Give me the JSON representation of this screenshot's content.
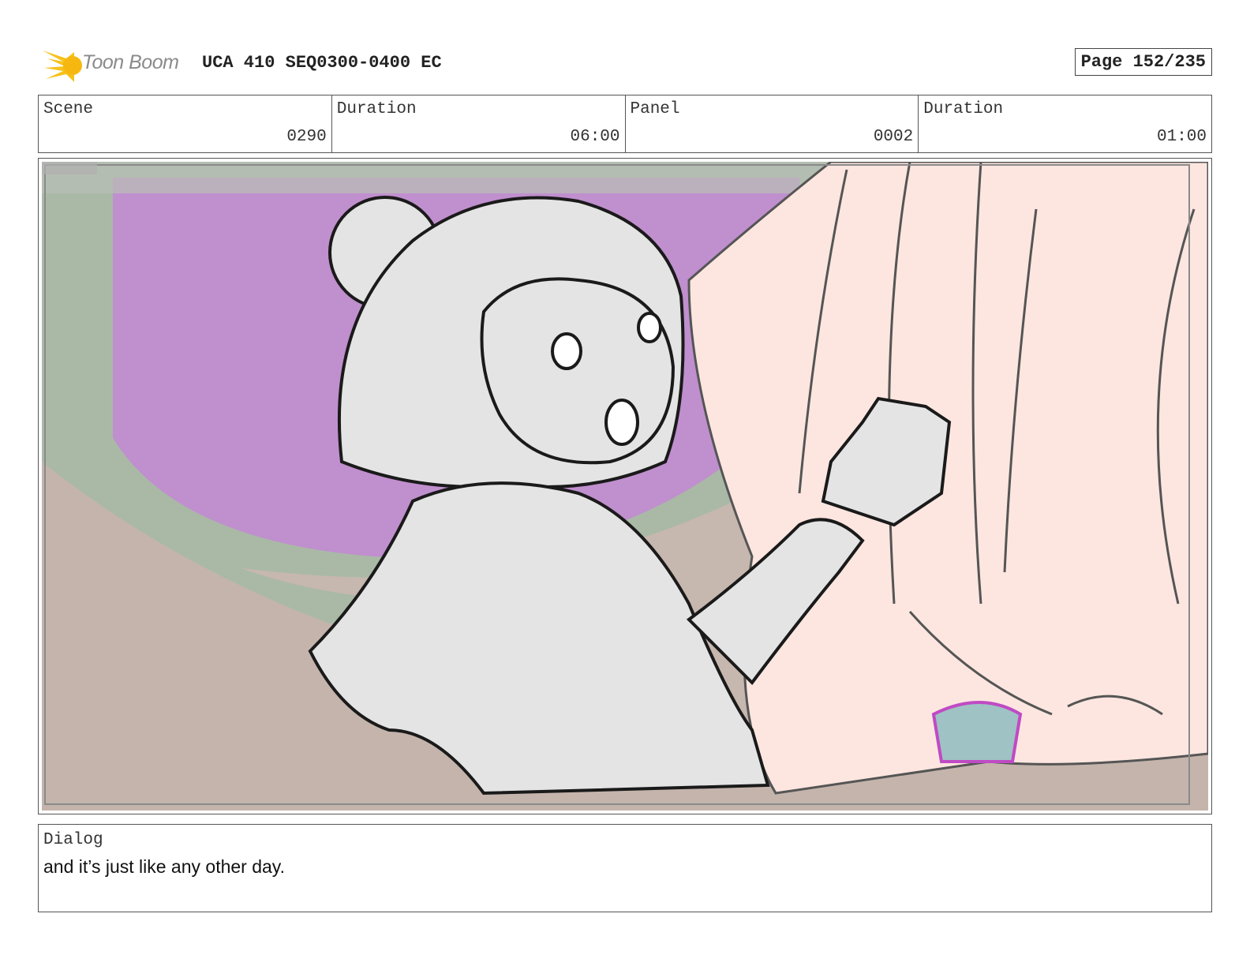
{
  "header": {
    "logo_text": "Toon Boom",
    "project_title": "UCA 410 SEQ0300-0400 EC",
    "page_label": "Page 152/235"
  },
  "info": {
    "scene": {
      "label": "Scene",
      "value": "0290"
    },
    "scene_duration": {
      "label": "Duration",
      "value": "06:00"
    },
    "panel": {
      "label": "Panel",
      "value": "0002"
    },
    "panel_duration": {
      "label": "Duration",
      "value": "01:00"
    }
  },
  "dialog": {
    "label": "Dialog",
    "text": "and it’s just like any other day."
  },
  "colors": {
    "purple_bg": "#c08fce",
    "green_pipe": "#a9b9a6",
    "floor_brown": "#c9b9b1",
    "pink_figure": "#fde6e0",
    "sketch_gray": "#e4e4e4"
  }
}
